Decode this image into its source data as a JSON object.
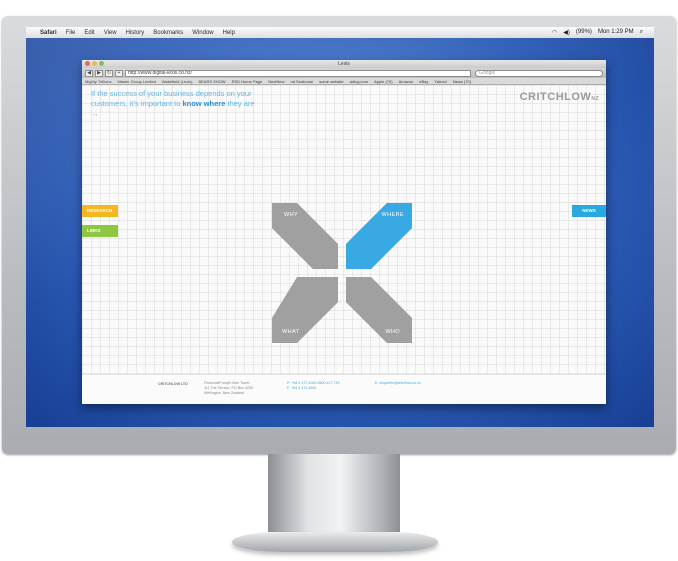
{
  "menubar": {
    "app": "Safari",
    "items": [
      "File",
      "Edit",
      "View",
      "History",
      "Bookmarks",
      "Window",
      "Help"
    ],
    "battery": "(99%)",
    "clock": "Mon 1:29 PM"
  },
  "browser": {
    "window_title": "Lexis",
    "url": "http://www.digital-lexis.co.nz/",
    "search_placeholder": "Google",
    "bookmarks": [
      "Mighty Trillions",
      "Master Group Limited",
      "Wakefield (Lexis)",
      "BEARS SHOW",
      "RSD Home Page",
      "NextNew",
      "nd Seahorse",
      "some website",
      "adlog.com",
      "Apple (70)",
      "Amazon",
      "eBay",
      "Yahoo!",
      "News (70)"
    ]
  },
  "page": {
    "tagline_pre": "If the success of your business depends on your customers, it's important to ",
    "tagline_bold": "know where",
    "tagline_post": " they are →",
    "logo": "CRITCHLOW",
    "logo_suffix": "NZ",
    "tabs": {
      "research": "RESEARCH",
      "links": "LINKS",
      "news": "NEWS"
    },
    "petals": {
      "why": "WHY",
      "where": "WHERE",
      "what": "WHAT",
      "who": "WHO"
    },
    "footer": {
      "company": "CRITCHLOW LTD",
      "address": [
        "Financial/Forsyth Barr Tower",
        "111 The Terrace, PO Box 4200",
        "Wellington, New Zealand"
      ],
      "phones": [
        "P: +64 4 472 4040   0800 427 749",
        "F: +64 4 472 4040"
      ],
      "email": "E: enquiries@critchlow.co.nz"
    }
  },
  "colors": {
    "accent_blue": "#39a9e3",
    "research": "#f3b51c",
    "links": "#8cc63f",
    "petal_grey": "#a0a0a0"
  }
}
